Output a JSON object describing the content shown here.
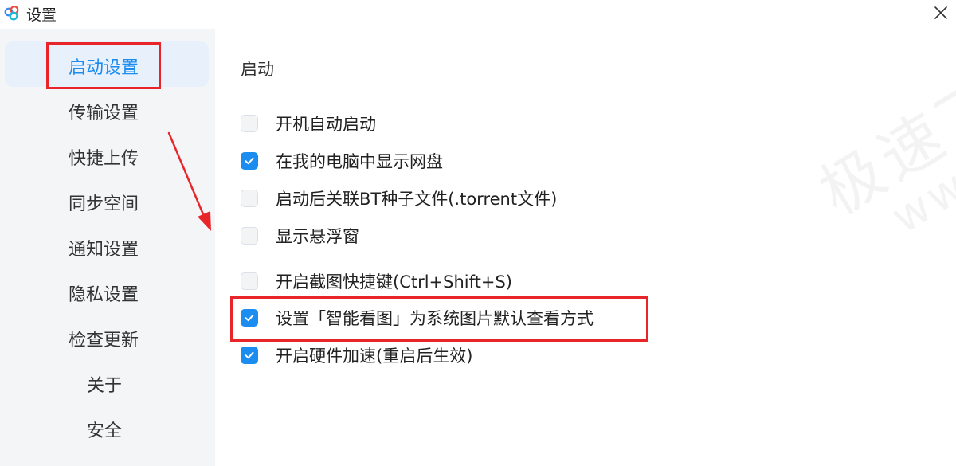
{
  "window": {
    "title": "设置",
    "icon": "baidu-netdisk-cloud-icon",
    "close_icon": "close-icon"
  },
  "sidebar": {
    "items": [
      {
        "label": "启动设置",
        "active": true
      },
      {
        "label": "传输设置",
        "active": false
      },
      {
        "label": "快捷上传",
        "active": false
      },
      {
        "label": "同步空间",
        "active": false
      },
      {
        "label": "通知设置",
        "active": false
      },
      {
        "label": "隐私设置",
        "active": false
      },
      {
        "label": "检查更新",
        "active": false
      },
      {
        "label": "关于",
        "active": false
      },
      {
        "label": "安全",
        "active": false
      }
    ]
  },
  "main": {
    "section_title": "启动",
    "options": [
      {
        "label": "开机自动启动",
        "checked": false
      },
      {
        "label": "在我的电脑中显示网盘",
        "checked": true
      },
      {
        "label": "启动后关联BT种子文件(.torrent文件)",
        "checked": false
      },
      {
        "label": "显示悬浮窗",
        "checked": false
      },
      {
        "label": "开启截图快捷键(Ctrl+Shift+S)",
        "checked": false
      },
      {
        "label": "设置「智能看图」为系统图片默认查看方式",
        "checked": true
      },
      {
        "label": "开启硬件加速(重启后生效)",
        "checked": true
      }
    ]
  },
  "watermark": {
    "line1": "极速下载站",
    "line2": "www.mydown.com"
  },
  "colors": {
    "accent": "#1b8cf0",
    "annotation": "#e8262a",
    "sidebar_bg": "#f4f5f7",
    "active_item_bg": "#e8f1fb"
  }
}
